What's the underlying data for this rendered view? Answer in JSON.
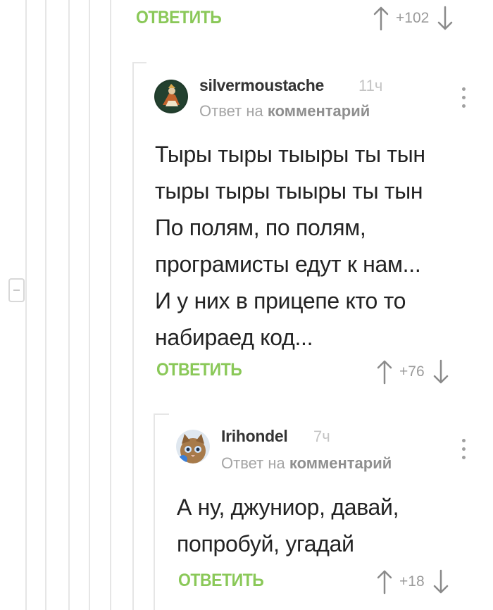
{
  "comments": [
    {
      "reply_label": "ОТВЕТИТЬ",
      "score": "+102"
    },
    {
      "username": "silvermoustache",
      "time": "11ч",
      "reply_prefix": "Ответ на",
      "reply_target": "комментарий",
      "text": "Тыры тыры тыыры ты тын\nтыры тыры тыыры ты тын\nПо полям, по полям,\nпрограмисты едут к нам...\nИ у них в прицепе кто то\nнабираед код...",
      "reply_label": "ОТВЕТИТЬ",
      "score": "+76"
    },
    {
      "username": "Irihondel",
      "time": "7ч",
      "reply_prefix": "Ответ на",
      "reply_target": "комментарий",
      "text": "А ну, джуниор, давай,\nпопробуй, угадай",
      "reply_label": "ОТВЕТИТЬ",
      "score": "+18"
    }
  ],
  "colors": {
    "reply_green": "#8ac858",
    "thread_line": "#e6e6e6",
    "muted_text": "#a5a5a5"
  },
  "icons": [
    "arrow-up-icon",
    "arrow-down-icon",
    "more-vertical-icon",
    "collapse-minus-icon"
  ]
}
